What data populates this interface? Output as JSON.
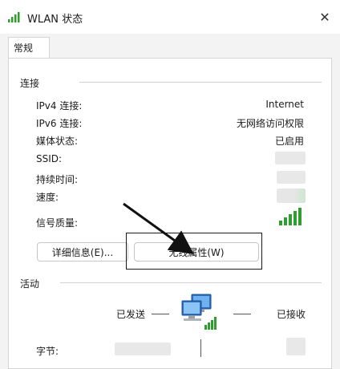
{
  "window": {
    "title": "WLAN 状态",
    "close_glyph": "✕"
  },
  "tabs": [
    {
      "label": "常规"
    }
  ],
  "connection": {
    "group_label": "连接",
    "rows": [
      {
        "label": "IPv4 连接:",
        "value": "Internet"
      },
      {
        "label": "IPv6 连接:",
        "value": "无网络访问权限"
      },
      {
        "label": "媒体状态:",
        "value": "已启用"
      },
      {
        "label": "SSID:",
        "value": ""
      },
      {
        "label": "持续时间:",
        "value": ""
      },
      {
        "label": "速度:",
        "value": ""
      }
    ],
    "signal_label": "信号质量:",
    "details_button": "详细信息(E)...",
    "wireless_props_button": "无线属性(W)"
  },
  "activity": {
    "group_label": "活动",
    "sent_label": "已发送",
    "received_label": "已接收",
    "bytes_label": "字节:"
  },
  "colors": {
    "signal_green": "#2e9e2e",
    "accent": "#0067c0"
  },
  "icons": {
    "title_icon": "wifi-signal-icon",
    "network_icon": "network-computers-icon"
  }
}
